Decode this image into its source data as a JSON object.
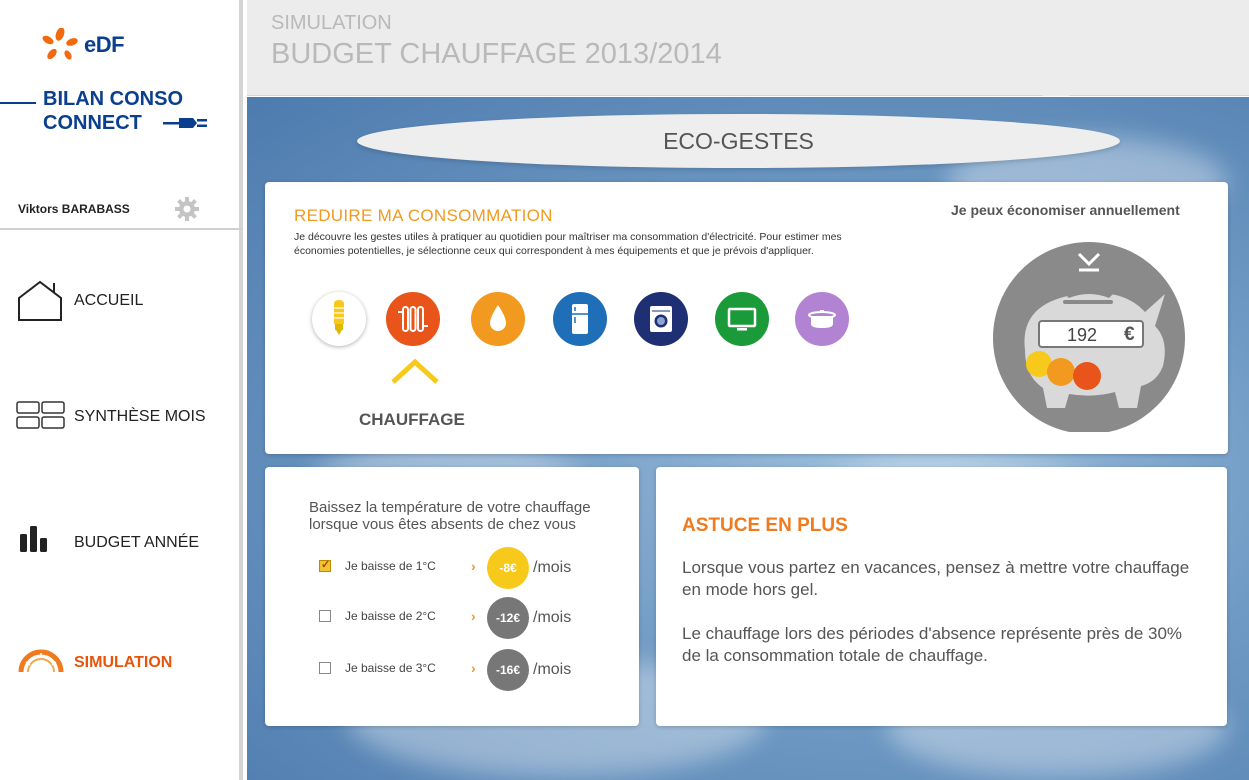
{
  "brand": {
    "logo_text": "eDF",
    "app_line1": "BILAN CONSO",
    "app_line2": "CONNECT"
  },
  "user": {
    "name": "Viktors BARABASS"
  },
  "nav": {
    "items": [
      {
        "label": "ACCUEIL",
        "icon": "home-icon"
      },
      {
        "label": "SYNTHÈSE MOIS",
        "icon": "grid-icon"
      },
      {
        "label": "BUDGET ANNÉE",
        "icon": "bar-chart-icon"
      },
      {
        "label": "SIMULATION",
        "icon": "gauge-icon",
        "active": true
      }
    ]
  },
  "header": {
    "subtitle": "SIMULATION",
    "title": "BUDGET CHAUFFAGE 2013/2014"
  },
  "eco": {
    "label": "ECO-GESTES"
  },
  "reduce": {
    "title": "REDUIRE MA CONSOMMATION",
    "description": "Je découvre les gestes utiles à pratiquer au quotidien pour maîtriser ma consommation d'électricité. Pour estimer mes économies potentielles, je sélectionne ceux qui correspondent à mes équipements et que je prévois d'appliquer.",
    "categories": [
      {
        "name": "lightbulb-icon",
        "color": "#ffffff"
      },
      {
        "name": "radiator-icon",
        "color": "#e8541a"
      },
      {
        "name": "water-drop-icon",
        "color": "#f29a1f"
      },
      {
        "name": "fridge-icon",
        "color": "#1e6fb8"
      },
      {
        "name": "washing-machine-icon",
        "color": "#1e2f73"
      },
      {
        "name": "tv-icon",
        "color": "#1b9a3a"
      },
      {
        "name": "cooking-pot-icon",
        "color": "#b283d2"
      }
    ],
    "selected_label": "CHAUFFAGE"
  },
  "savings": {
    "title": "Je peux économiser annuellement",
    "amount": "192",
    "currency": "€"
  },
  "temperature": {
    "title": "Baissez la température de votre chauffage lorsque vous êtes absents de chez vous",
    "options": [
      {
        "label": "Je baisse de 1°C",
        "value": "-8€",
        "unit": "/mois",
        "checked": true
      },
      {
        "label": "Je baisse de 2°C",
        "value": "-12€",
        "unit": "/mois",
        "checked": false
      },
      {
        "label": "Je baisse de 3°C",
        "value": "-16€",
        "unit": "/mois",
        "checked": false
      }
    ]
  },
  "astuce": {
    "title": "ASTUCE EN PLUS",
    "p1": "Lorsque vous partez en vacances, pensez à mettre votre chauffage en mode hors gel.",
    "p2": "Le chauffage lors des périodes d'absence représente près de 30% de la consommation totale de chauffage."
  },
  "colors": {
    "accent": "#f07a1e",
    "brand_blue": "#0a3e8f",
    "badge_on": "#f7c91a",
    "badge_off": "#777777"
  }
}
